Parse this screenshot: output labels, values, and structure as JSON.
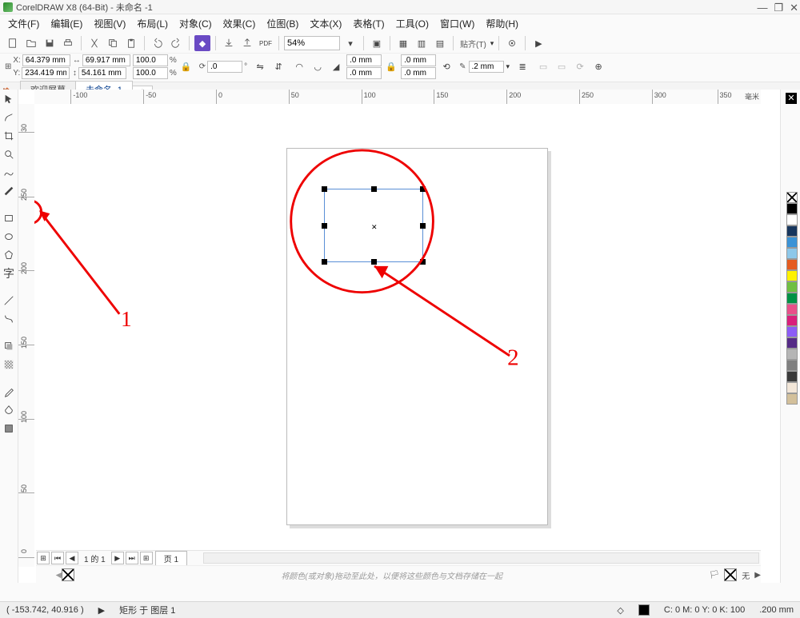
{
  "app": {
    "title": "CorelDRAW X8 (64-Bit) - 未命名 -1"
  },
  "menu": {
    "items": [
      "文件(F)",
      "编辑(E)",
      "视图(V)",
      "布局(L)",
      "对象(C)",
      "效果(C)",
      "位图(B)",
      "文本(X)",
      "表格(T)",
      "工具(O)",
      "窗口(W)",
      "帮助(H)"
    ]
  },
  "toolbar": {
    "zoom": "54%",
    "align": "贴齐(T)"
  },
  "prop": {
    "x": "64.379 mm",
    "y": "234.419 mm",
    "w": "69.917 mm",
    "h": "54.161 mm",
    "sx": "100.0",
    "sy": "100.0",
    "unit": "%",
    "rot": ".0",
    "corner1": ".0 mm",
    "corner2": ".0 mm",
    "corner3": ".0 mm",
    "corner4": ".0 mm",
    "outline": ".2 mm"
  },
  "tabs": {
    "welcome": "欢迎屏幕",
    "doc": "未命名 -1"
  },
  "ruler": {
    "h": [
      "-100",
      "-50",
      "0",
      "50",
      "100",
      "150",
      "200",
      "250",
      "300",
      "350"
    ],
    "unit": "毫米",
    "v": [
      "30",
      "250",
      "200",
      "150",
      "100",
      "50",
      "0"
    ]
  },
  "palette": [
    "#000000",
    "#ffffff",
    "#17365d",
    "#3b93d6",
    "#8dc8ea",
    "#e55b1f",
    "#fff200",
    "#70bf41",
    "#009245",
    "#e94f8a",
    "#d91f7b",
    "#8c5cf6",
    "#552b86",
    "#b5b5b5",
    "#7f7f7f",
    "#3a3a3a",
    "#f2e6d8",
    "#d3c09b"
  ],
  "pagenav": {
    "pos": "1 的 1",
    "page": "页 1"
  },
  "status": {
    "coords": "( -153.742, 40.916 )",
    "obj": "矩形 于 图层 1",
    "fill": "C: 0 M: 0 Y: 0 K: 100",
    "outline": ".200 mm",
    "nofill": "无"
  },
  "hint": "将颜色(或对象)拖动至此处，以便将这些颜色与文档存储在一起",
  "annotations": {
    "1": "1",
    "2": "2"
  }
}
